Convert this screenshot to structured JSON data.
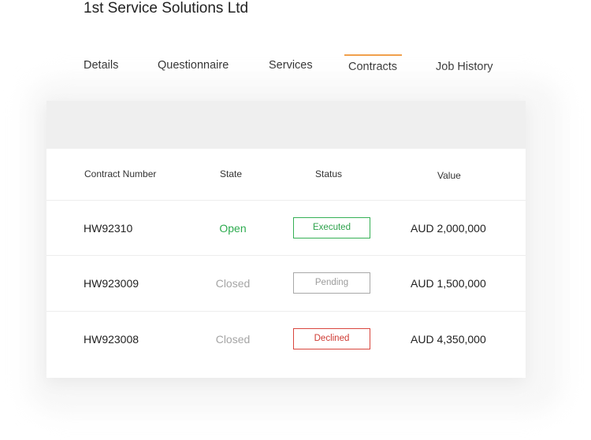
{
  "company": {
    "name": "1st Service Solutions Ltd"
  },
  "tabs": [
    {
      "label": "Details",
      "active": false
    },
    {
      "label": "Questionnaire",
      "active": false
    },
    {
      "label": "Services",
      "active": false
    },
    {
      "label": "Contracts",
      "active": true
    },
    {
      "label": "Job History",
      "active": false
    }
  ],
  "colors": {
    "tab_active_accent": "#f0a04b",
    "open": "#2dab4f",
    "closed": "#a5a5a5",
    "executed": "#35b055",
    "pending": "#a8a8a8",
    "declined": "#d9463e"
  },
  "table": {
    "columns": [
      "Contract Number",
      "State",
      "Status",
      "Value"
    ],
    "rows": [
      {
        "contract_number": "HW92310",
        "state": "Open",
        "status": "Executed",
        "value": "AUD 2,000,000"
      },
      {
        "contract_number": "HW923009",
        "state": "Closed",
        "status": "Pending",
        "value": "AUD 1,500,000"
      },
      {
        "contract_number": "HW923008",
        "state": "Closed",
        "status": "Declined",
        "value": "AUD 4,350,000"
      }
    ]
  }
}
